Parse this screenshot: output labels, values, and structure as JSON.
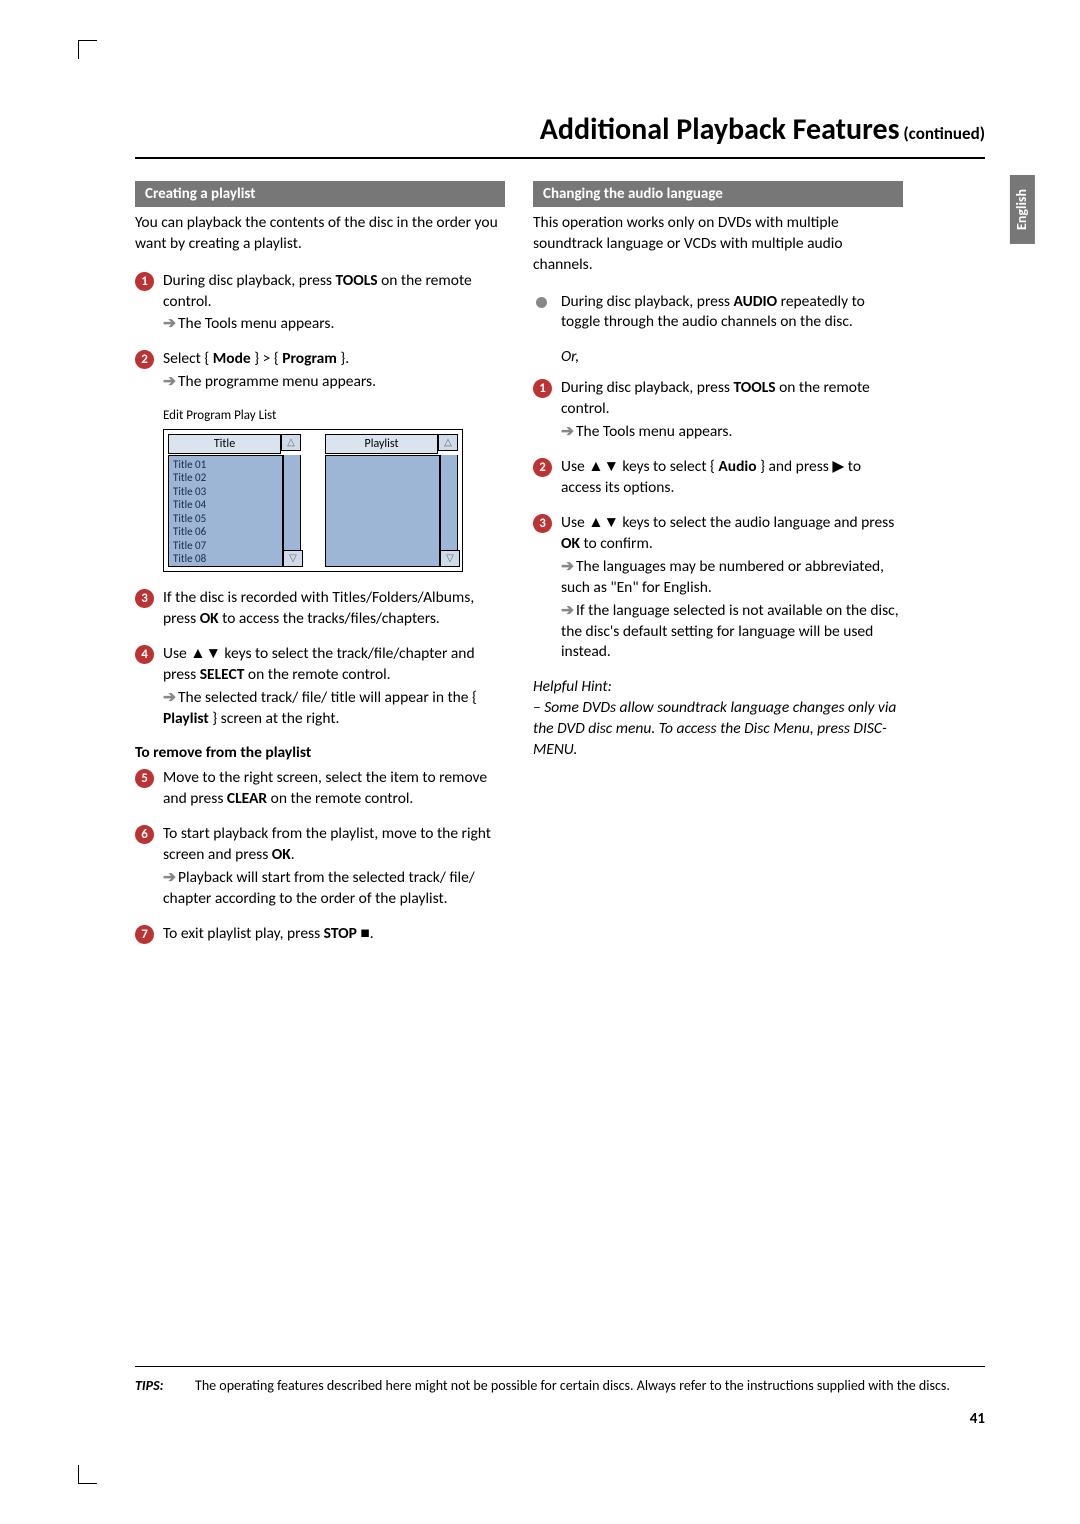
{
  "page": {
    "title_main": "Additional Playback Features",
    "title_sub": " (continued)",
    "language_tab": "English",
    "page_number": "41"
  },
  "left": {
    "section_title": "Creating a playlist",
    "intro": "You can playback the contents of the disc in the order you want by creating a playlist.",
    "step1_a": "During disc playback, press ",
    "step1_b": "TOOLS",
    "step1_c": " on the remote control.",
    "step1_res": "The Tools menu appears.",
    "step2_a": "Select { ",
    "step2_b": "Mode",
    "step2_c": " } > { ",
    "step2_d": "Program",
    "step2_e": " }.",
    "step2_res": "The programme menu appears.",
    "eppl_caption": "Edit Program Play List",
    "eppl_col1": "Title",
    "eppl_col2": "Playlist",
    "eppl_items": [
      "Title 01",
      "Title 02",
      "Title 03",
      "Title 04",
      "Title 05",
      "Title 06",
      "Title 07",
      "Title 08"
    ],
    "step3_a": "If the disc is recorded with Titles/Folders/Albums, press ",
    "step3_b": "OK",
    "step3_c": " to access the tracks/files/chapters.",
    "step4_a": "Use ▲▼ keys to select the track/file/chapter and press ",
    "step4_b": "SELECT",
    "step4_c": " on the remote control.",
    "step4_res_a": "The selected track/ file/ title will appear in the { ",
    "step4_res_b": "Playlist",
    "step4_res_c": " } screen at the right.",
    "sub_heading": "To remove from the playlist",
    "step5_a": "Move to the right screen, select the item to remove and press ",
    "step5_b": "CLEAR",
    "step5_c": " on the remote control.",
    "step6_a": "To start playback from the playlist, move to the right screen and press ",
    "step6_b": "OK",
    "step6_c": ".",
    "step6_res": "Playback will start from the selected track/ file/ chapter according to the order of the playlist.",
    "step7_a": "To exit playlist play, press ",
    "step7_b": "STOP",
    "step7_c": " ■."
  },
  "right": {
    "section_title": "Changing the audio language",
    "intro": "This operation works only on DVDs with multiple soundtrack language or VCDs with multiple audio channels.",
    "bullet_a": "During disc playback, press ",
    "bullet_b": "AUDIO",
    "bullet_c": " repeatedly to toggle through the audio channels on the disc.",
    "or": "Or,",
    "step1_a": "During disc playback, press ",
    "step1_b": "TOOLS",
    "step1_c": " on the remote control.",
    "step1_res": "The Tools menu appears.",
    "step2_a": "Use ▲▼ keys to select { ",
    "step2_b": "Audio",
    "step2_c": " } and press ▶ to access its options.",
    "step3_a": "Use ▲▼ keys to select the audio language and press ",
    "step3_b": "OK",
    "step3_c": " to confirm.",
    "step3_res1": "The languages may be numbered or abbreviated, such as \"En\" for English.",
    "step3_res2": "If the language selected is not available on the disc, the disc's default setting for language will be used instead.",
    "hint_label": "Helpful Hint:",
    "hint_body": "– Some DVDs allow soundtrack language changes only via the DVD disc menu. To access the Disc Menu, press DISC-MENU."
  },
  "tips": {
    "label": "TIPS:",
    "body": "The operating features described here might not be possible for certain discs. Always refer to the instructions supplied with the discs."
  }
}
